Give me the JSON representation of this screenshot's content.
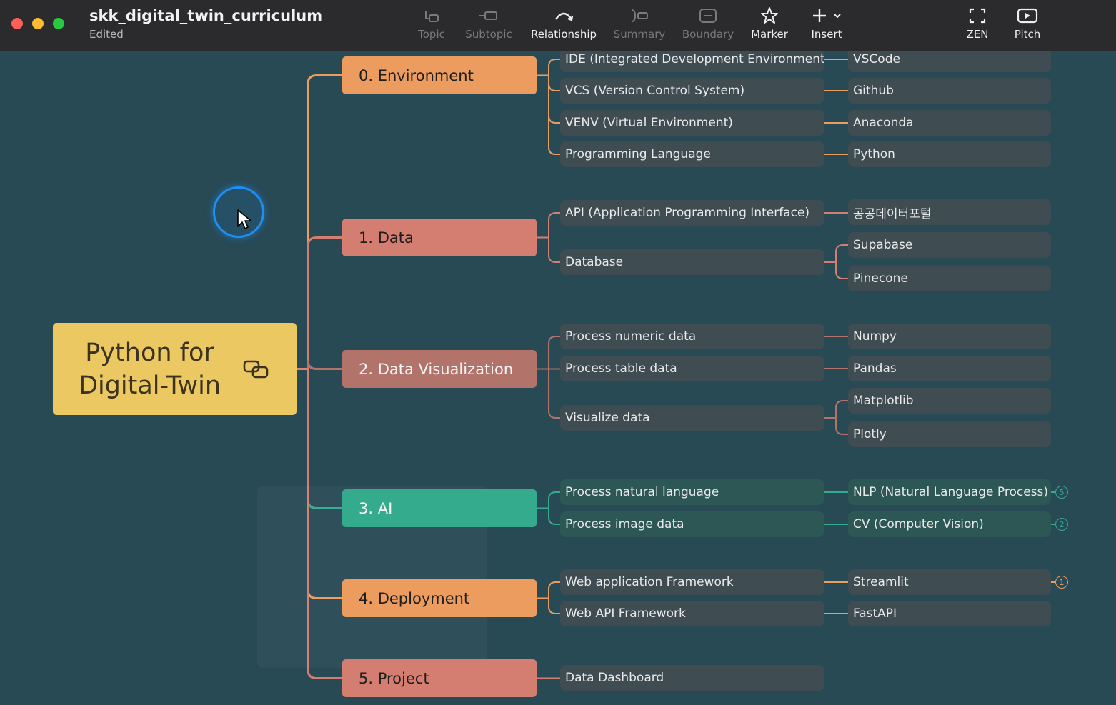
{
  "window": {
    "title": "skk_digital_twin_curriculum",
    "subtitle": "Edited"
  },
  "toolbar": {
    "items": [
      {
        "label": "Topic",
        "icon": "topic-icon",
        "enabled": false
      },
      {
        "label": "Subtopic",
        "icon": "subtopic-icon",
        "enabled": false
      },
      {
        "label": "Relationship",
        "icon": "relationship-icon",
        "enabled": true
      },
      {
        "label": "Summary",
        "icon": "summary-icon",
        "enabled": false
      },
      {
        "label": "Boundary",
        "icon": "boundary-icon",
        "enabled": false
      },
      {
        "label": "Marker",
        "icon": "star-icon",
        "enabled": true
      },
      {
        "label": "Insert",
        "icon": "plus-icon",
        "enabled": true
      }
    ],
    "right_items": [
      {
        "label": "ZEN",
        "icon": "fullscreen-icon"
      },
      {
        "label": "Pitch",
        "icon": "play-icon"
      }
    ]
  },
  "colors": {
    "canvas": "#284a55",
    "central": "#ecc862",
    "orange": "#eb9c5e",
    "salmon": "#d37e70",
    "brown": "#b1736a",
    "teal": "#34ab8d"
  },
  "mindmap": {
    "central": {
      "line1": "Python for",
      "line2": "Digital-Twin"
    },
    "branches": [
      {
        "label": "0. Environment",
        "color": "#eb9c5e"
      },
      {
        "label": "1. Data",
        "color": "#d37e70"
      },
      {
        "label": "2. Data Visualization",
        "color": "#b1736a"
      },
      {
        "label": "3. AI",
        "color": "#34ab8d"
      },
      {
        "label": "4. Deployment",
        "color": "#eb9c5e"
      },
      {
        "label": "5. Project",
        "color": "#d37e70"
      }
    ],
    "subtopics": [
      "IDE (Integrated Development Environment)",
      "VCS (Version Control System)",
      "VENV (Virtual Environment)",
      "Programming Language",
      "API (Application Programming Interface)",
      "Database",
      "Process numeric data",
      "Process table data",
      "Visualize data",
      "Process natural language",
      "Process image data",
      "Web application Framework",
      "Web API Framework",
      "Data Dashboard"
    ],
    "leaves": [
      "VSCode",
      "Github",
      "Anaconda",
      "Python",
      "공공데이터포털",
      "Supabase",
      "Pinecone",
      "Numpy",
      "Pandas",
      "Matplotlib",
      "Plotly",
      "NLP (Natural Language Process)",
      "CV (Computer Vision)",
      "Streamlit",
      "FastAPI"
    ],
    "collapsed_counts": [
      {
        "leaf": "NLP (Natural Language Process)",
        "count": "5"
      },
      {
        "leaf": "CV (Computer Vision)",
        "count": "2"
      },
      {
        "leaf": "Streamlit",
        "count": "1"
      }
    ]
  }
}
